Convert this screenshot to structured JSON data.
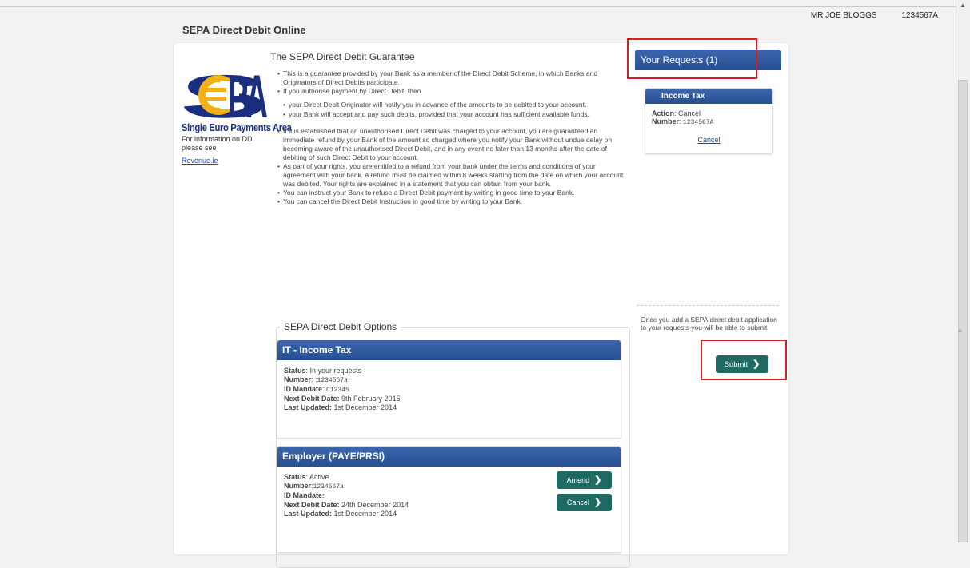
{
  "user": {
    "name": "MR JOE BLOGGS",
    "number": "1234567A"
  },
  "page": {
    "title": "SEPA Direct Debit Online"
  },
  "logo": {
    "caption": "Single Euro Payments Area",
    "info_text": "For information on DD please see",
    "link_label": "Revenue.ie"
  },
  "guarantee": {
    "title": "The SEPA Direct Debit Guarantee",
    "bullets": [
      "This is a guarantee provided by your Bank as a member of the Direct Debit Scheme, in which Banks and Originators of Direct Debits participate.",
      "If you authorise payment by Direct Debit, then",
      "If it is established that an unauthorised Direct Debit was charged to your account, you are guaranteed an immediate refund by your Bank of the amount so charged where you notify your Bank without undue delay on becoming aware of the unauthorised Direct Debit, and in any event no later than 13 months after the date of debiting of such Direct Debit to your account.",
      "As part of your rights, you are entitled to a refund from your bank under the terms and conditions of your agreement with your bank. A refund must be claimed within 8 weeks starting from the date on which your account was debited. Your rights are explained in a statement that you can obtain from your bank.",
      "You can instruct your Bank to refuse a Direct Debit payment by writing in good time to your Bank.",
      "You can cancel the Direct Debit Instruction in good time by writing to your Bank."
    ],
    "sub_bullets": [
      "your Direct Debit Originator will notify you in advance of the amounts to be debited to your account.",
      "your Bank will accept and pay such debits, provided that your account has sufficient available funds."
    ]
  },
  "options": {
    "title": "SEPA Direct Debit Options",
    "labels": {
      "status": "Status",
      "number": "Number",
      "id_mandate": "ID Mandate",
      "next_debit": "Next Debit Date:",
      "last_updated": "Last Updated:"
    },
    "cards": [
      {
        "header": "IT - Income Tax",
        "status": "In your requests",
        "number": "1234567a",
        "id_mandate": "C12345",
        "next_debit": "9th February 2015",
        "last_updated": "1st December 2014"
      },
      {
        "header": "Employer (PAYE/PRSI)",
        "status": "Active",
        "number": "1234567a",
        "id_mandate": "",
        "next_debit": "24th December 2014",
        "last_updated": "1st December 2014",
        "amend_label": "Amend",
        "cancel_label": "Cancel"
      }
    ]
  },
  "requests": {
    "title": "Your Requests (1)",
    "item": {
      "header": "Income Tax",
      "action_label": "Action",
      "action_value": "Cancel",
      "number_label": "Number",
      "number_value": "1234567A",
      "cancel_link": "Cancel"
    },
    "note": "Once you add a SEPA direct debit application to your requests you will be able to submit",
    "submit_label": "Submit"
  },
  "colors": {
    "header_blue": "#2d5a9e",
    "button_teal": "#1f6b63",
    "highlight_red": "#d21f26"
  },
  "icons": [
    "chevron-right-icon"
  ]
}
